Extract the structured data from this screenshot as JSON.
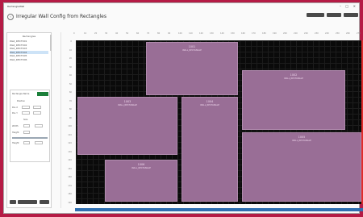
{
  "window": {
    "title": "RectangleWall"
  },
  "header": {
    "title": "Irregular Wall Config from Rectangles"
  },
  "tree": {
    "header": "Rectangles",
    "items": [
      {
        "label": "Wall_RECT001",
        "selected": false
      },
      {
        "label": "Wall_RECT002",
        "selected": false
      },
      {
        "label": "Wall_RECT003",
        "selected": false
      },
      {
        "label": "Wall_RECT004",
        "selected": true
      },
      {
        "label": "Wall_RECT005",
        "selected": false
      },
      {
        "label": "Wall_RECT006",
        "selected": false
      }
    ]
  },
  "props": {
    "name_label": "Rectangle Name",
    "pos_label": "Position",
    "x_label": "Pos X",
    "y_label": "Pos Y",
    "size_label": "Size",
    "w_label": "Width",
    "h_label": "Height"
  },
  "ruler_top": [
    "0",
    "10",
    "20",
    "30",
    "40",
    "50",
    "60",
    "70",
    "80",
    "90",
    "100",
    "110",
    "120",
    "130",
    "140",
    "150",
    "160",
    "170",
    "180",
    "190",
    "200",
    "210",
    "220",
    "230",
    "240",
    "250",
    "260",
    "270"
  ],
  "ruler_left": [
    "0",
    "10",
    "20",
    "30",
    "40",
    "50",
    "60",
    "70",
    "80",
    "90",
    "100",
    "110",
    "120",
    "130",
    "140",
    "150",
    "160",
    "170",
    "180",
    "190"
  ],
  "rects": [
    {
      "id": "1001",
      "type": "WALL_RECTANGLE"
    },
    {
      "id": "1002",
      "type": "WALL_RECTANGLE"
    },
    {
      "id": "1003",
      "type": "WALL_RECTANGLE"
    },
    {
      "id": "1004",
      "type": "WALL_RECTANGLE"
    },
    {
      "id": "1005",
      "type": "WALL_RECTANGLE"
    },
    {
      "id": "1006",
      "type": "WALL_RECTANGLE"
    }
  ],
  "colors": {
    "wall": "#996e96",
    "grid_bg": "#0a0a0a",
    "accent": "#2f6fb1",
    "background": "#b51b45"
  }
}
